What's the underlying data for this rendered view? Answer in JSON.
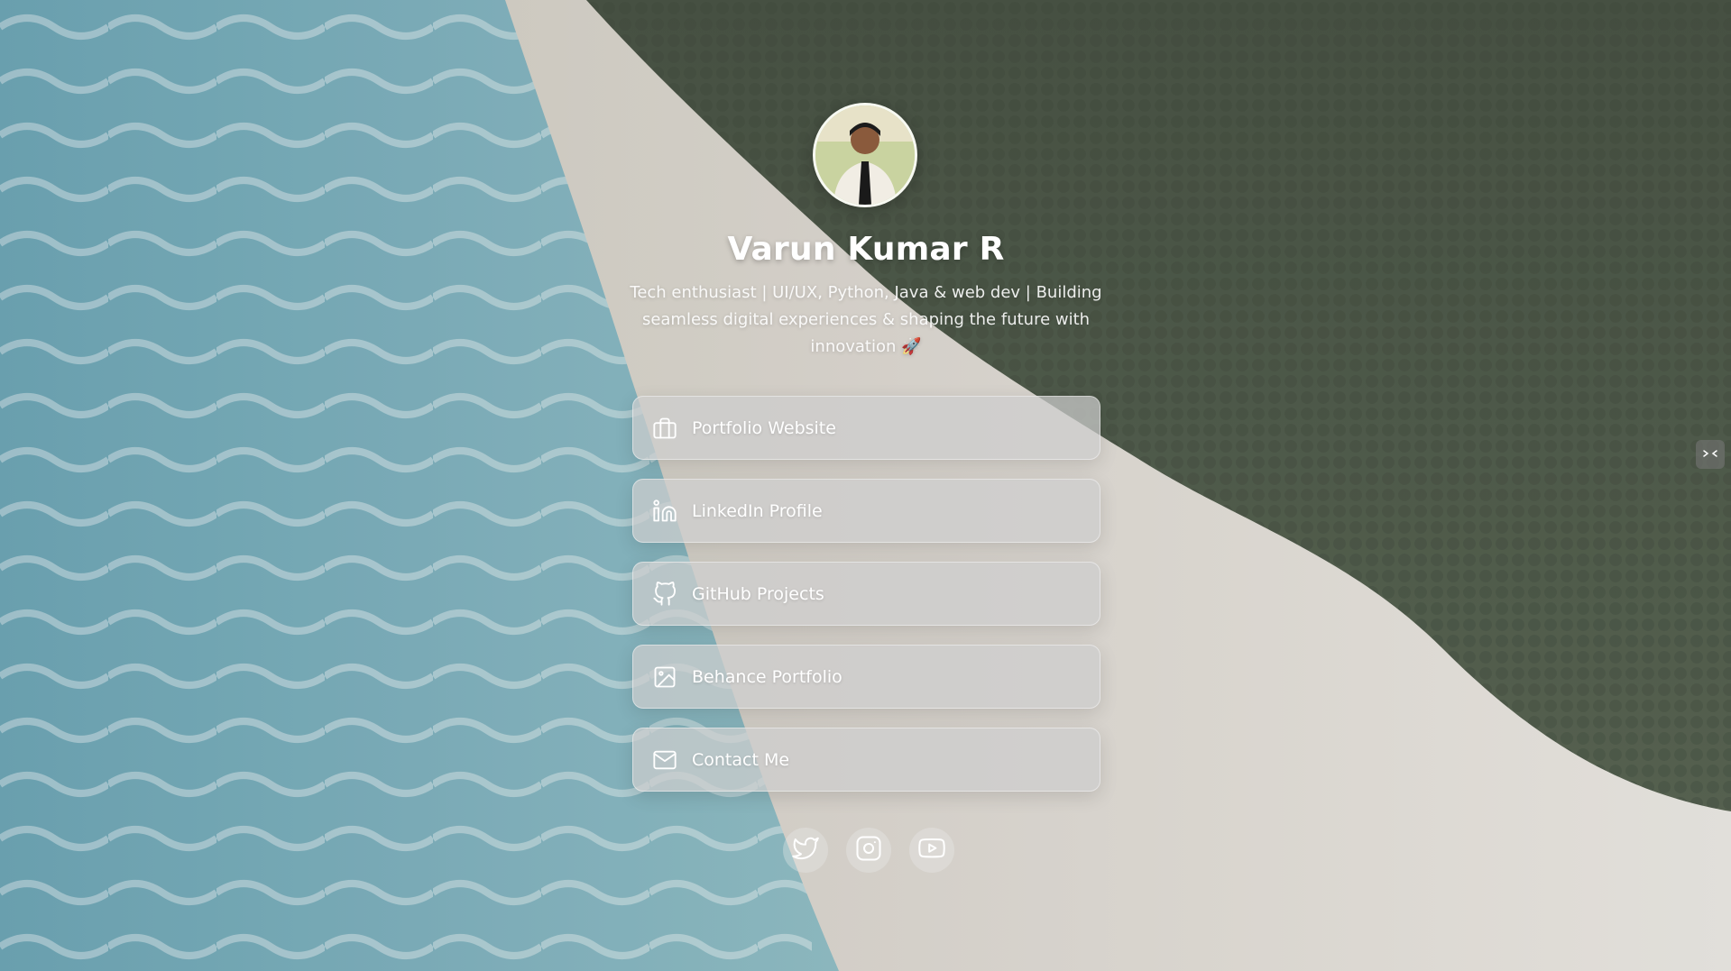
{
  "profile": {
    "name": "Varun Kumar R",
    "bio": "Tech enthusiast | UI/UX, Python, Java & web dev | Building seamless digital experiences & shaping the future with innovation 🚀"
  },
  "links": [
    {
      "label": "Portfolio Website",
      "icon": "briefcase-icon"
    },
    {
      "label": "LinkedIn Profile",
      "icon": "linkedin-icon"
    },
    {
      "label": "GitHub Projects",
      "icon": "github-icon"
    },
    {
      "label": "Behance Portfolio",
      "icon": "image-icon"
    },
    {
      "label": "Contact Me",
      "icon": "mail-icon"
    }
  ],
  "socials": [
    {
      "icon": "twitter-icon"
    },
    {
      "icon": "instagram-icon"
    },
    {
      "icon": "youtube-icon"
    }
  ],
  "colors": {
    "ocean": "#7fb3c0",
    "sand": "#e9e5de",
    "forest": "#4e5a48",
    "button_bg": "#cdcdcd",
    "text": "#ffffff"
  }
}
